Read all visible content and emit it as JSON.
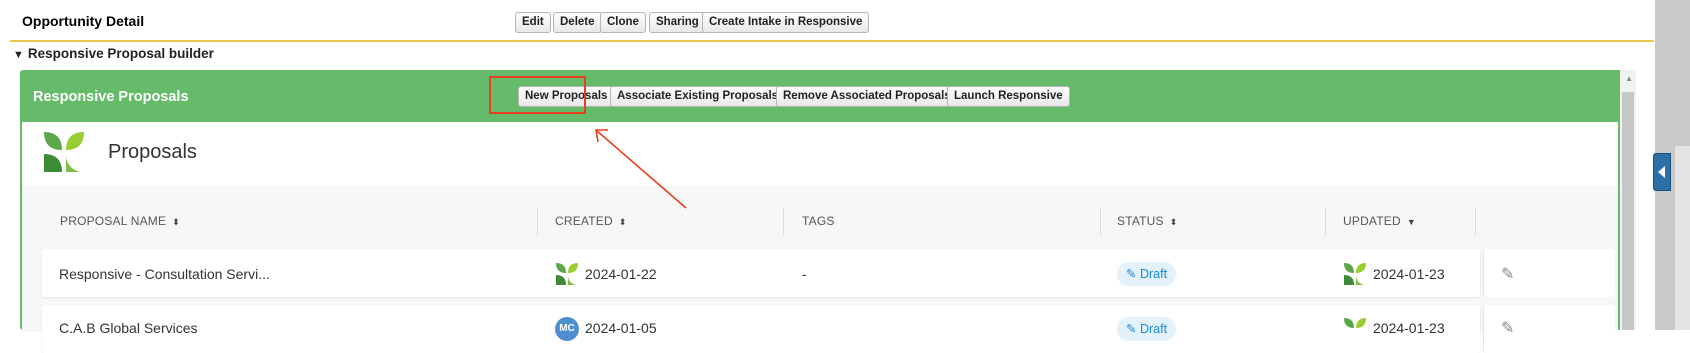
{
  "header": {
    "title": "Opportunity Detail",
    "buttons": {
      "edit": "Edit",
      "delete": "Delete",
      "clone": "Clone",
      "sharing": "Sharing",
      "create_intake": "Create Intake in Responsive"
    }
  },
  "section": {
    "label": "Responsive Proposal builder",
    "expanded": true
  },
  "panel": {
    "title": "Responsive Proposals",
    "buttons": {
      "new_proposals": "New Proposals",
      "associate": "Associate Existing Proposals",
      "remove": "Remove Associated Proposals",
      "launch": "Launch Responsive"
    }
  },
  "proposals": {
    "title": "Proposals",
    "columns": {
      "name": "PROPOSAL NAME",
      "created": "CREATED",
      "tags": "TAGS",
      "status": "STATUS",
      "updated": "UPDATED"
    },
    "rows": [
      {
        "name": "Responsive - Consultation Servi...",
        "created": "2024-01-22",
        "tags": "-",
        "status": "Draft",
        "updated": "2024-01-23"
      },
      {
        "name": "C.A.B Global Services",
        "creator_initials": "MC",
        "created": "2024-01-05",
        "tags": "-",
        "status": "Draft",
        "updated": "2024-01-23"
      }
    ]
  },
  "icons": {
    "brand_logo": "responsive-logo-icon",
    "sort": "sort-icon",
    "edit": "pencil-icon"
  },
  "colors": {
    "panel_green": "#66bb6a",
    "highlight_red": "#e8401c",
    "status_blue": "#1a8ad8",
    "divider_gold": "#e6c74a"
  }
}
